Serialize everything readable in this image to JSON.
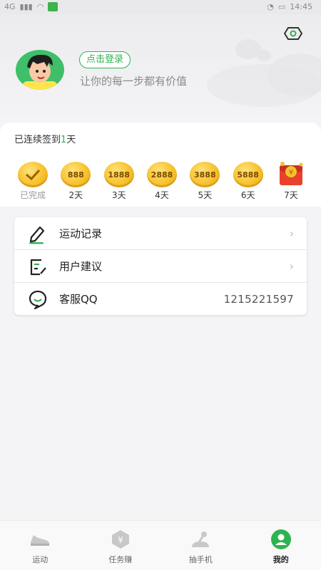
{
  "status_bar": {
    "network": "4G",
    "time": "14:45"
  },
  "header": {
    "login_label": "点击登录",
    "tagline": "让你的每一步都有价值"
  },
  "signin": {
    "streak_prefix": "已连续签到",
    "streak_days": "1",
    "streak_suffix": "天",
    "days": [
      {
        "coin": "",
        "label": "已完成"
      },
      {
        "coin": "888",
        "label": "2天"
      },
      {
        "coin": "1888",
        "label": "3天"
      },
      {
        "coin": "2888",
        "label": "4天"
      },
      {
        "coin": "3888",
        "label": "5天"
      },
      {
        "coin": "5888",
        "label": "6天"
      },
      {
        "coin": "¥",
        "label": "7天"
      }
    ]
  },
  "menu": {
    "exercise_record": "运动记录",
    "user_feedback": "用户建议",
    "support_qq": "客服QQ",
    "support_qq_number": "1215221597"
  },
  "tabbar": {
    "tabs": [
      {
        "label": "运动"
      },
      {
        "label": "任务赚"
      },
      {
        "label": "抽手机"
      },
      {
        "label": "我的"
      }
    ]
  },
  "colors": {
    "accent": "#2fb34f",
    "coin": "#f7c22e",
    "redpacket": "#e8412c"
  }
}
